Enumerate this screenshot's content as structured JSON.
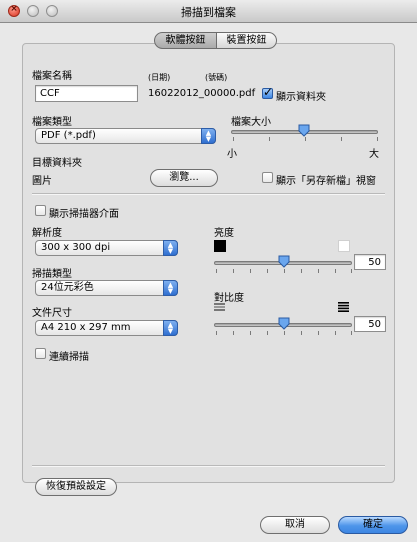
{
  "window": {
    "title": "掃描到檔案"
  },
  "tabs": [
    {
      "label": "軟體按鈕",
      "selected": true
    },
    {
      "label": "裝置按鈕",
      "selected": false
    }
  ],
  "file_name": {
    "label": "檔案名稱",
    "value": "CCF",
    "date_label": "(日期)",
    "number_label": "(號碼)",
    "generated_name": "16022012_00000.pdf",
    "show_folder_label": "顯示資料夾",
    "show_folder_checked": true
  },
  "file_type": {
    "label": "檔案類型",
    "value": "PDF (*.pdf)"
  },
  "file_size": {
    "label": "檔案大小",
    "min_label": "小",
    "max_label": "大",
    "level": 0.5
  },
  "destination": {
    "label": "目標資料夾",
    "value": "圖片",
    "browse_label": "瀏覽...",
    "show_save_as_label": "顯示「另存新檔」視窗",
    "show_save_as_checked": false
  },
  "scanner_interface": {
    "label": "顯示掃描器介面",
    "checked": false
  },
  "resolution": {
    "label": "解析度",
    "value": "300 x 300 dpi"
  },
  "scan_type": {
    "label": "掃描類型",
    "value": "24位元彩色"
  },
  "document_size": {
    "label": "文件尺寸",
    "value": "A4 210 x 297 mm"
  },
  "continuous_scan": {
    "label": "連續掃描",
    "checked": false
  },
  "brightness": {
    "label": "亮度",
    "value": "50"
  },
  "contrast": {
    "label": "對比度",
    "value": "50"
  },
  "restore_defaults_label": "恢復預設設定",
  "cancel_label": "取消",
  "ok_label": "確定"
}
